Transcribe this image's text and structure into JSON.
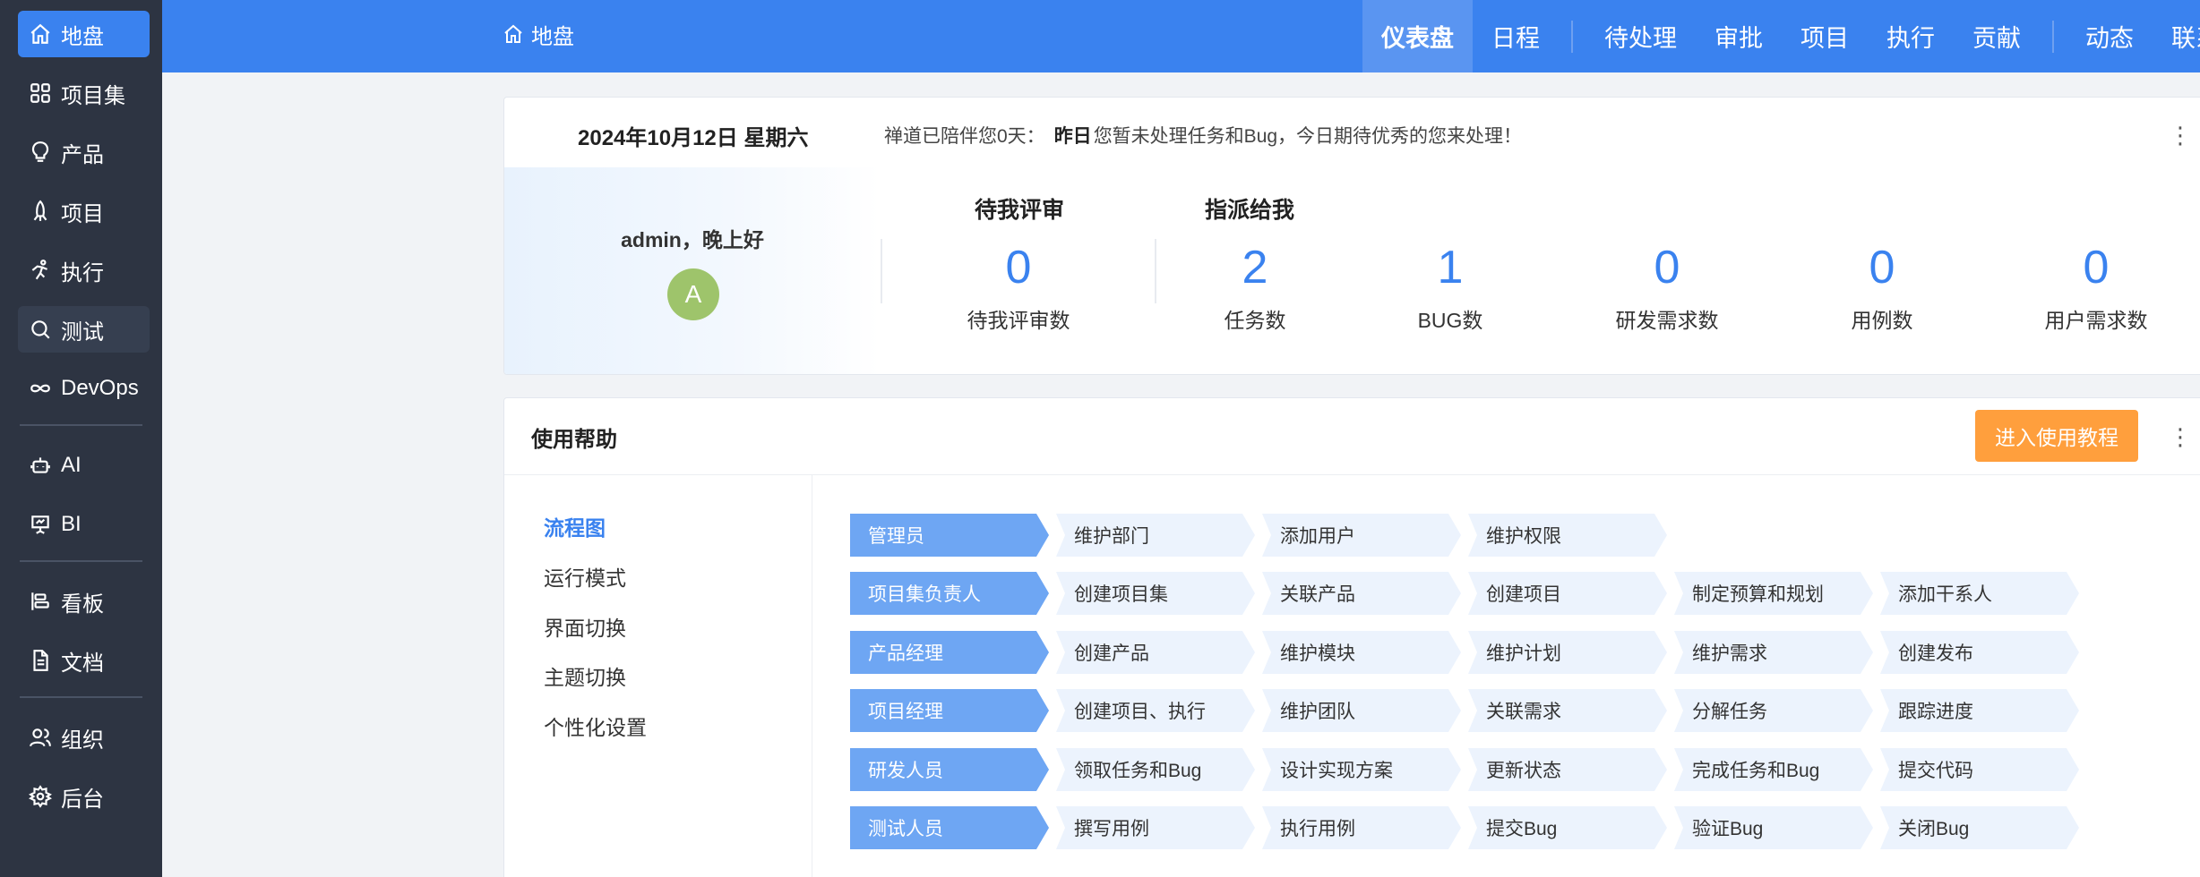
{
  "sidebar": {
    "items": [
      {
        "label": "地盘",
        "icon": "home-icon"
      },
      {
        "label": "项目集",
        "icon": "grid-icon"
      },
      {
        "label": "产品",
        "icon": "lightbulb-icon"
      },
      {
        "label": "项目",
        "icon": "rocket-icon"
      },
      {
        "label": "执行",
        "icon": "run-icon"
      },
      {
        "label": "测试",
        "icon": "search-icon"
      },
      {
        "label": "DevOps",
        "icon": "infinity-icon"
      },
      {
        "label": "AI",
        "icon": "robot-icon"
      },
      {
        "label": "BI",
        "icon": "presentation-icon"
      },
      {
        "label": "看板",
        "icon": "kanban-icon"
      },
      {
        "label": "文档",
        "icon": "document-icon"
      },
      {
        "label": "组织",
        "icon": "users-icon"
      },
      {
        "label": "后台",
        "icon": "gear-icon"
      }
    ]
  },
  "header": {
    "breadcrumb": "地盘",
    "nav": [
      "仪表盘",
      "日程",
      "待处理",
      "审批",
      "项目",
      "执行",
      "贡献",
      "动态",
      "联系人"
    ]
  },
  "welcome": {
    "date": "2024年10月12日 星期六",
    "msg_prefix": "禅道已陪伴您0天：",
    "msg_bold": "昨日",
    "msg_suffix": "您暂未处理任务和Bug，今日期待优秀的您来处理！",
    "greeting": "admin，晚上好",
    "avatar_letter": "A",
    "group_review": "待我评审",
    "group_assigned": "指派给我",
    "stats": [
      {
        "value": "0",
        "label": "待我评审数"
      },
      {
        "value": "2",
        "label": "任务数"
      },
      {
        "value": "1",
        "label": "BUG数"
      },
      {
        "value": "0",
        "label": "研发需求数"
      },
      {
        "value": "0",
        "label": "用例数"
      },
      {
        "value": "0",
        "label": "用户需求数"
      }
    ]
  },
  "help": {
    "title": "使用帮助",
    "button": "进入使用教程",
    "nav": [
      "流程图",
      "运行模式",
      "界面切换",
      "主题切换",
      "个性化设置"
    ],
    "flow": [
      {
        "role": "管理员",
        "steps": [
          "维护部门",
          "添加用户",
          "维护权限"
        ]
      },
      {
        "role": "项目集负责人",
        "steps": [
          "创建项目集",
          "关联产品",
          "创建项目",
          "制定预算和规划",
          "添加干系人"
        ]
      },
      {
        "role": "产品经理",
        "steps": [
          "创建产品",
          "维护模块",
          "维护计划",
          "维护需求",
          "创建发布"
        ]
      },
      {
        "role": "项目经理",
        "steps": [
          "创建项目、执行",
          "维护团队",
          "关联需求",
          "分解任务",
          "跟踪进度"
        ]
      },
      {
        "role": "研发人员",
        "steps": [
          "领取任务和Bug",
          "设计实现方案",
          "更新状态",
          "完成任务和Bug",
          "提交代码"
        ]
      },
      {
        "role": "测试人员",
        "steps": [
          "撰写用例",
          "执行用例",
          "提交Bug",
          "验证Bug",
          "关闭Bug"
        ]
      }
    ]
  }
}
